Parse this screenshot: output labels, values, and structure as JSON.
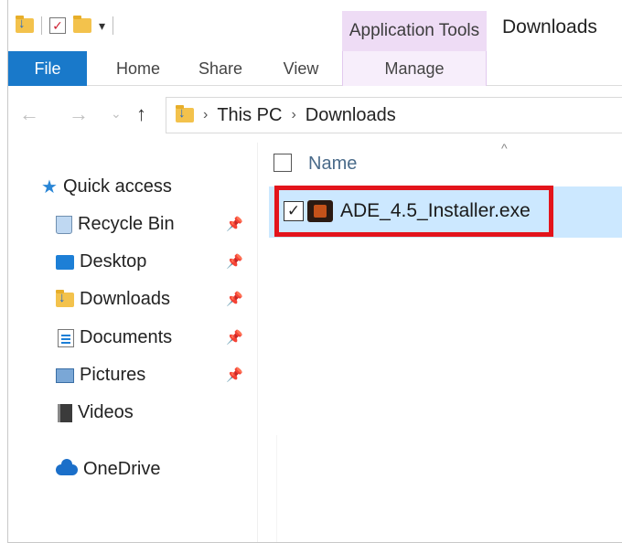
{
  "titlebar": {
    "context_tab": "Application Tools",
    "window_title": "Downloads"
  },
  "ribbon": {
    "tabs": [
      {
        "label": "File"
      },
      {
        "label": "Home"
      },
      {
        "label": "Share"
      },
      {
        "label": "View"
      },
      {
        "label": "Manage"
      }
    ]
  },
  "address": {
    "crumbs": [
      "This PC",
      "Downloads"
    ]
  },
  "nav": {
    "quick_access": "Quick access",
    "items": [
      {
        "label": "Recycle Bin",
        "icon": "recycle-bin-icon",
        "pinned": true
      },
      {
        "label": "Desktop",
        "icon": "desktop-folder-icon",
        "pinned": true
      },
      {
        "label": "Downloads",
        "icon": "downloads-folder-icon",
        "pinned": true
      },
      {
        "label": "Documents",
        "icon": "documents-icon",
        "pinned": true
      },
      {
        "label": "Pictures",
        "icon": "pictures-icon",
        "pinned": true
      },
      {
        "label": "Videos",
        "icon": "videos-icon",
        "pinned": false
      }
    ],
    "onedrive": "OneDrive"
  },
  "content": {
    "column_header": "Name",
    "files": [
      {
        "name": "ADE_4.5_Installer.exe",
        "checked": true,
        "selected": true
      }
    ]
  },
  "colors": {
    "file_tab": "#1979ca",
    "selection": "#cce8ff",
    "highlight_box": "#e3141b",
    "context_tab": "#eedcf5"
  }
}
